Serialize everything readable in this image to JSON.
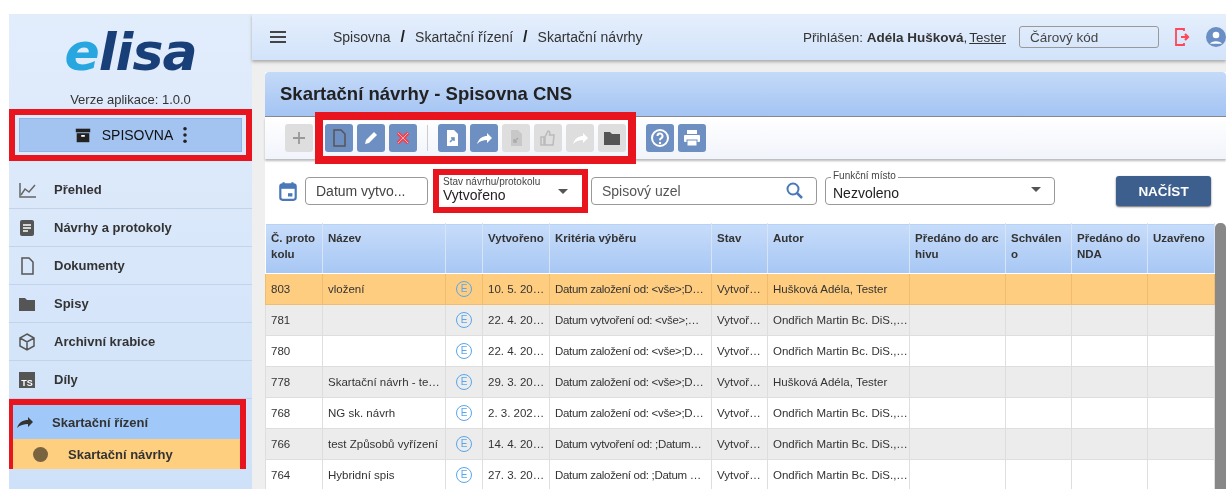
{
  "sidebar": {
    "logo": "elisa",
    "version": "Verze aplikace: 1.0.0",
    "section": {
      "label": "SPISOVNA",
      "highlighted": true
    },
    "items": [
      {
        "label": "Přehled",
        "selected": false,
        "highlighted": false
      },
      {
        "label": "Návrhy a protokoly",
        "selected": false,
        "highlighted": false
      },
      {
        "label": "Dokumenty",
        "selected": false,
        "highlighted": false
      },
      {
        "label": "Spisy",
        "selected": false,
        "highlighted": false
      },
      {
        "label": "Archivní krabice",
        "selected": false,
        "highlighted": false
      },
      {
        "label": "Díly",
        "badge": "TS",
        "selected": false,
        "highlighted": false
      },
      {
        "label": "Skartační řízení",
        "selected": true,
        "highlighted": true,
        "children": [
          {
            "label": "Skartační návrhy",
            "selected": true
          }
        ]
      }
    ]
  },
  "topbar": {
    "breadcrumbs": [
      "Spisovna",
      "Skartační řízení",
      "Skartační návrhy"
    ],
    "separator": "/",
    "login": "Přihlášen: **Adéla Hušková**,",
    "role": "Tester",
    "barcode": {
      "placeholder": "Čárový kód"
    }
  },
  "panel": {
    "title": "Skartační návrhy - Spisovna CNS",
    "toolbar": [
      {
        "highlighted": false,
        "groups": [
          [
            {
              "disabled": true
            }
          ]
        ]
      },
      {
        "highlighted": true,
        "groups": [
          [
            {
              "disabled": false
            },
            {
              "disabled": false
            },
            {
              "disabled": false
            }
          ],
          [
            {
              "disabled": false
            },
            {
              "disabled": false
            },
            {
              "disabled": true
            },
            {
              "disabled": true
            },
            {
              "disabled": true
            },
            {
              "disabled": true
            }
          ]
        ]
      },
      {
        "highlighted": false,
        "groups": [
          [
            {
              "disabled": false
            },
            {
              "disabled": false
            }
          ]
        ]
      }
    ],
    "filters": {
      "date": {
        "placeholder": "Datum vytvo..."
      },
      "status": {
        "label": "Stav návrhu/protokolu",
        "value": "Vytvořeno",
        "highlighted": true
      },
      "node": {
        "placeholder": "Spisový uzel"
      },
      "place": {
        "label": "Funkční místo",
        "value": "Nezvoleno"
      },
      "load_button": "NAČÍST"
    },
    "table": {
      "columns": [
        "Č. protokolu",
        "Název",
        "",
        "Vytvořeno",
        "Kritéria výběru",
        "Stav",
        "Autor",
        "Předáno do archivu",
        "Schváleno",
        "Předáno do NDA",
        "Uzavřeno"
      ],
      "rows": [
        {
          "selected": true,
          "cells": [
            "803",
            "vložení",
            "E",
            "10. 5. 20…",
            "Datum založení od: <vše>;D…",
            "Vytvoř…",
            "Hušková Adéla, Tester",
            "",
            "",
            "",
            ""
          ]
        },
        {
          "selected": false,
          "cells": [
            "781",
            "",
            "E",
            "22. 4. 20…",
            "Datum vytvoření od: <vše>;…",
            "Vytvoř…",
            "Ondřich Martin Bc. DiS.,…",
            "",
            "",
            "",
            ""
          ]
        },
        {
          "selected": false,
          "cells": [
            "780",
            "",
            "E",
            "22. 4. 20…",
            "Datum založení od: <vše>;D…",
            "Vytvoř…",
            "Ondřich Martin Bc. DiS.,…",
            "",
            "",
            "",
            ""
          ]
        },
        {
          "selected": false,
          "cells": [
            "778",
            "Skartační návrh - te…",
            "E",
            "29. 3. 20…",
            "Datum založení od: <vše>;D…",
            "Vytvoř…",
            "Hušková Adéla, Tester",
            "",
            "",
            "",
            ""
          ]
        },
        {
          "selected": false,
          "cells": [
            "768",
            "NG sk. návrh",
            "E",
            "2. 3. 202…",
            "Datum založení od: <vše>;D…",
            "Vytvoř…",
            "Ondřich Martin Bc. DiS.,…",
            "",
            "",
            "",
            ""
          ]
        },
        {
          "selected": false,
          "cells": [
            "766",
            "test Způsobů vyřízení",
            "E",
            "14. 4. 20…",
            "Datum vytvoření od: ;Datum…",
            "Vytvoř…",
            "Ondřich Martin Bc. DiS.,…",
            "",
            "",
            "",
            ""
          ]
        },
        {
          "selected": false,
          "cells": [
            "764",
            "Hybridní spis",
            "E",
            "27. 3. 20…",
            "Datum založení od: ;Datum …",
            "Vytvoř…",
            "Ondřich Martin Bc. DiS.,…",
            "",
            "",
            "",
            ""
          ]
        }
      ]
    }
  }
}
